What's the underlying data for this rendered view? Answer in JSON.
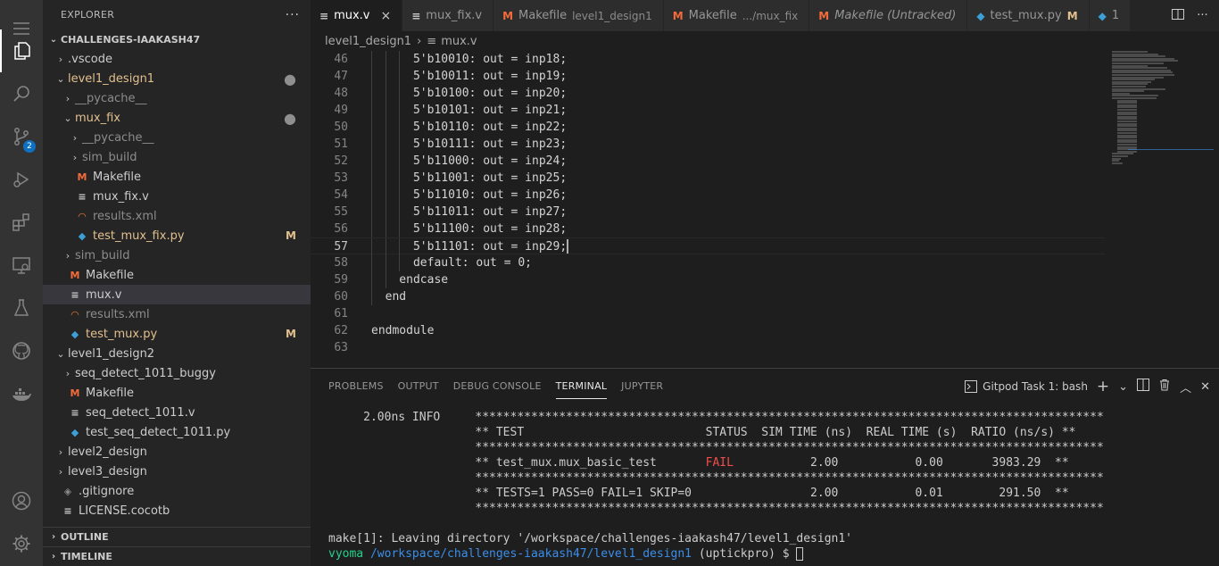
{
  "activity_bar": {
    "scm_badge": "2"
  },
  "sidebar": {
    "title": "EXPLORER",
    "more": "···",
    "root": "CHALLENGES-IAAKASH47",
    "tree": [
      {
        "indent": 0,
        "arrow": "›",
        "label": "vscode_prefix",
        "text": ".vscode",
        "icon": "",
        "cls": "",
        "deco": ""
      },
      {
        "indent": 0,
        "arrow": "⌄",
        "text": "level1_design1",
        "icon": "",
        "cls": "c-mod",
        "deco": "●"
      },
      {
        "indent": 1,
        "arrow": "›",
        "text": "__pycache__",
        "icon": "",
        "cls": "c-gray",
        "deco": ""
      },
      {
        "indent": 1,
        "arrow": "⌄",
        "text": "mux_fix",
        "icon": "",
        "cls": "c-mod",
        "deco": "●"
      },
      {
        "indent": 2,
        "arrow": "›",
        "text": "__pycache__",
        "icon": "",
        "cls": "c-gray",
        "deco": ""
      },
      {
        "indent": 2,
        "arrow": "›",
        "text": "sim_build",
        "icon": "",
        "cls": "c-gray",
        "deco": ""
      },
      {
        "indent": 2,
        "arrow": "",
        "text": "Makefile",
        "icon": "M",
        "icls": "ic-m",
        "cls": "",
        "deco": ""
      },
      {
        "indent": 2,
        "arrow": "",
        "text": "mux_fix.v",
        "icon": "≡",
        "icls": "ic-v",
        "cls": "",
        "deco": ""
      },
      {
        "indent": 2,
        "arrow": "",
        "text": "results.xml",
        "icon": "◠",
        "icls": "ic-rss",
        "cls": "c-gray",
        "deco": ""
      },
      {
        "indent": 2,
        "arrow": "",
        "text": "test_mux_fix.py",
        "icon": "◆",
        "icls": "ic-py",
        "cls": "c-mod",
        "deco": "M"
      },
      {
        "indent": 1,
        "arrow": "›",
        "text": "sim_build",
        "icon": "",
        "cls": "c-gray",
        "deco": ""
      },
      {
        "indent": 1,
        "arrow": "",
        "text": "Makefile",
        "icon": "M",
        "icls": "ic-m",
        "cls": "",
        "deco": ""
      },
      {
        "indent": 1,
        "arrow": "",
        "text": "mux.v",
        "icon": "≡",
        "icls": "ic-v",
        "cls": "",
        "deco": "",
        "selected": true
      },
      {
        "indent": 1,
        "arrow": "",
        "text": "results.xml",
        "icon": "◠",
        "icls": "ic-rss",
        "cls": "c-gray",
        "deco": ""
      },
      {
        "indent": 1,
        "arrow": "",
        "text": "test_mux.py",
        "icon": "◆",
        "icls": "ic-py",
        "cls": "c-mod",
        "deco": "M"
      },
      {
        "indent": 0,
        "arrow": "⌄",
        "text": "level1_design2",
        "icon": "",
        "cls": "",
        "deco": ""
      },
      {
        "indent": 1,
        "arrow": "›",
        "text": "seq_detect_1011_buggy",
        "icon": "",
        "cls": "",
        "deco": ""
      },
      {
        "indent": 1,
        "arrow": "",
        "text": "Makefile",
        "icon": "M",
        "icls": "ic-m",
        "cls": "",
        "deco": ""
      },
      {
        "indent": 1,
        "arrow": "",
        "text": "seq_detect_1011.v",
        "icon": "≡",
        "icls": "ic-v",
        "cls": "",
        "deco": ""
      },
      {
        "indent": 1,
        "arrow": "",
        "text": "test_seq_detect_1011.py",
        "icon": "◆",
        "icls": "ic-py",
        "cls": "",
        "deco": ""
      },
      {
        "indent": 0,
        "arrow": "›",
        "text": "level2_design",
        "icon": "",
        "cls": "",
        "deco": ""
      },
      {
        "indent": 0,
        "arrow": "›",
        "text": "level3_design",
        "icon": "",
        "cls": "",
        "deco": ""
      },
      {
        "indent": 0,
        "arrow": "",
        "text": ".gitignore",
        "icon": "◈",
        "icls": "c-gray",
        "cls": "",
        "deco": ""
      },
      {
        "indent": 0,
        "arrow": "",
        "text": "LICENSE.cocotb",
        "icon": "≡",
        "icls": "ic-v",
        "cls": "",
        "deco": ""
      }
    ],
    "outline": "OUTLINE",
    "timeline": "TIMELINE"
  },
  "tabs": [
    {
      "icon": "≡",
      "icls": "ic-v",
      "label": "mux.v",
      "desc": "",
      "active": true,
      "close": "×",
      "mod": ""
    },
    {
      "icon": "≡",
      "icls": "ic-v",
      "label": "mux_fix.v",
      "desc": "",
      "active": false,
      "close": "",
      "mod": ""
    },
    {
      "icon": "M",
      "icls": "ic-m",
      "label": "Makefile",
      "desc": "level1_design1",
      "active": false,
      "close": "",
      "mod": ""
    },
    {
      "icon": "M",
      "icls": "ic-m",
      "label": "Makefile",
      "desc": ".../mux_fix",
      "active": false,
      "close": "",
      "mod": ""
    },
    {
      "icon": "M",
      "icls": "ic-m",
      "label": "Makefile (Untracked)",
      "desc": "",
      "active": false,
      "close": "",
      "mod": "",
      "italic": true
    },
    {
      "icon": "◆",
      "icls": "ic-py",
      "label": "test_mux.py",
      "desc": "",
      "active": false,
      "close": "",
      "mod": "M"
    },
    {
      "icon": "◆",
      "icls": "ic-py",
      "label": "1",
      "desc": "",
      "active": false,
      "close": "",
      "mod": ""
    }
  ],
  "breadcrumb": {
    "folder": "level1_design1",
    "file": "mux.v",
    "sep": "›"
  },
  "code": {
    "current_line": 57,
    "lines": [
      {
        "n": "46",
        "t": "      5'b10010: out = inp18;",
        "g": 3
      },
      {
        "n": "47",
        "t": "      5'b10011: out = inp19;",
        "g": 3
      },
      {
        "n": "48",
        "t": "      5'b10100: out = inp20;",
        "g": 3
      },
      {
        "n": "49",
        "t": "      5'b10101: out = inp21;",
        "g": 3
      },
      {
        "n": "50",
        "t": "      5'b10110: out = inp22;",
        "g": 3
      },
      {
        "n": "51",
        "t": "      5'b10111: out = inp23;",
        "g": 3
      },
      {
        "n": "52",
        "t": "      5'b11000: out = inp24;",
        "g": 3
      },
      {
        "n": "53",
        "t": "      5'b11001: out = inp25;",
        "g": 3
      },
      {
        "n": "54",
        "t": "      5'b11010: out = inp26;",
        "g": 3
      },
      {
        "n": "55",
        "t": "      5'b11011: out = inp27;",
        "g": 3
      },
      {
        "n": "56",
        "t": "      5'b11100: out = inp28;",
        "g": 3
      },
      {
        "n": "57",
        "t": "      5'b11101: out = inp29;",
        "g": 3
      },
      {
        "n": "58",
        "t": "      default: out = 0;",
        "g": 3
      },
      {
        "n": "59",
        "t": "    endcase",
        "g": 2
      },
      {
        "n": "60",
        "t": "  end",
        "g": 1
      },
      {
        "n": "61",
        "t": "",
        "g": 0
      },
      {
        "n": "62",
        "t": "endmodule",
        "g": 0
      },
      {
        "n": "63",
        "t": "",
        "g": 0
      }
    ]
  },
  "panel": {
    "tabs": [
      "PROBLEMS",
      "OUTPUT",
      "DEBUG CONSOLE",
      "TERMINAL",
      "JUPYTER"
    ],
    "active_tab": "TERMINAL",
    "terminal_name": "Gitpod Task 1: bash",
    "plus": "+",
    "chevron": "⌄",
    "up": "︿",
    "close": "✕"
  },
  "terminal": {
    "lines": [
      {
        "pre": "     2.00ns INFO     ",
        "txt": "******************************************************************************************",
        "fail": "",
        "post": ""
      },
      {
        "pre": "                     ",
        "txt": "** TEST                          STATUS  SIM TIME (ns)  REAL TIME (s)  RATIO (ns/s) **",
        "fail": "",
        "post": ""
      },
      {
        "pre": "                     ",
        "txt": "******************************************************************************************",
        "fail": "",
        "post": ""
      },
      {
        "pre": "                     ",
        "txt": "** test_mux.mux_basic_test       ",
        "fail": "FAIL",
        "post": "           2.00           0.00       3983.29  **"
      },
      {
        "pre": "                     ",
        "txt": "******************************************************************************************",
        "fail": "",
        "post": ""
      },
      {
        "pre": "                     ",
        "txt": "** TESTS=1 PASS=0 FAIL=1 SKIP=0                 2.00           0.01        291.50  **",
        "fail": "",
        "post": ""
      },
      {
        "pre": "                     ",
        "txt": "******************************************************************************************",
        "fail": "",
        "post": ""
      },
      {
        "pre": "",
        "txt": "",
        "fail": "",
        "post": ""
      },
      {
        "pre": "",
        "txt": "make[1]: Leaving directory '/workspace/challenges-iaakash47/level1_design1'",
        "fail": "",
        "post": ""
      }
    ],
    "prompt_user": "vyoma",
    "prompt_path": "/workspace/challenges-iaakash47/level1_design1",
    "prompt_rest": " (uptickpro) $ "
  }
}
